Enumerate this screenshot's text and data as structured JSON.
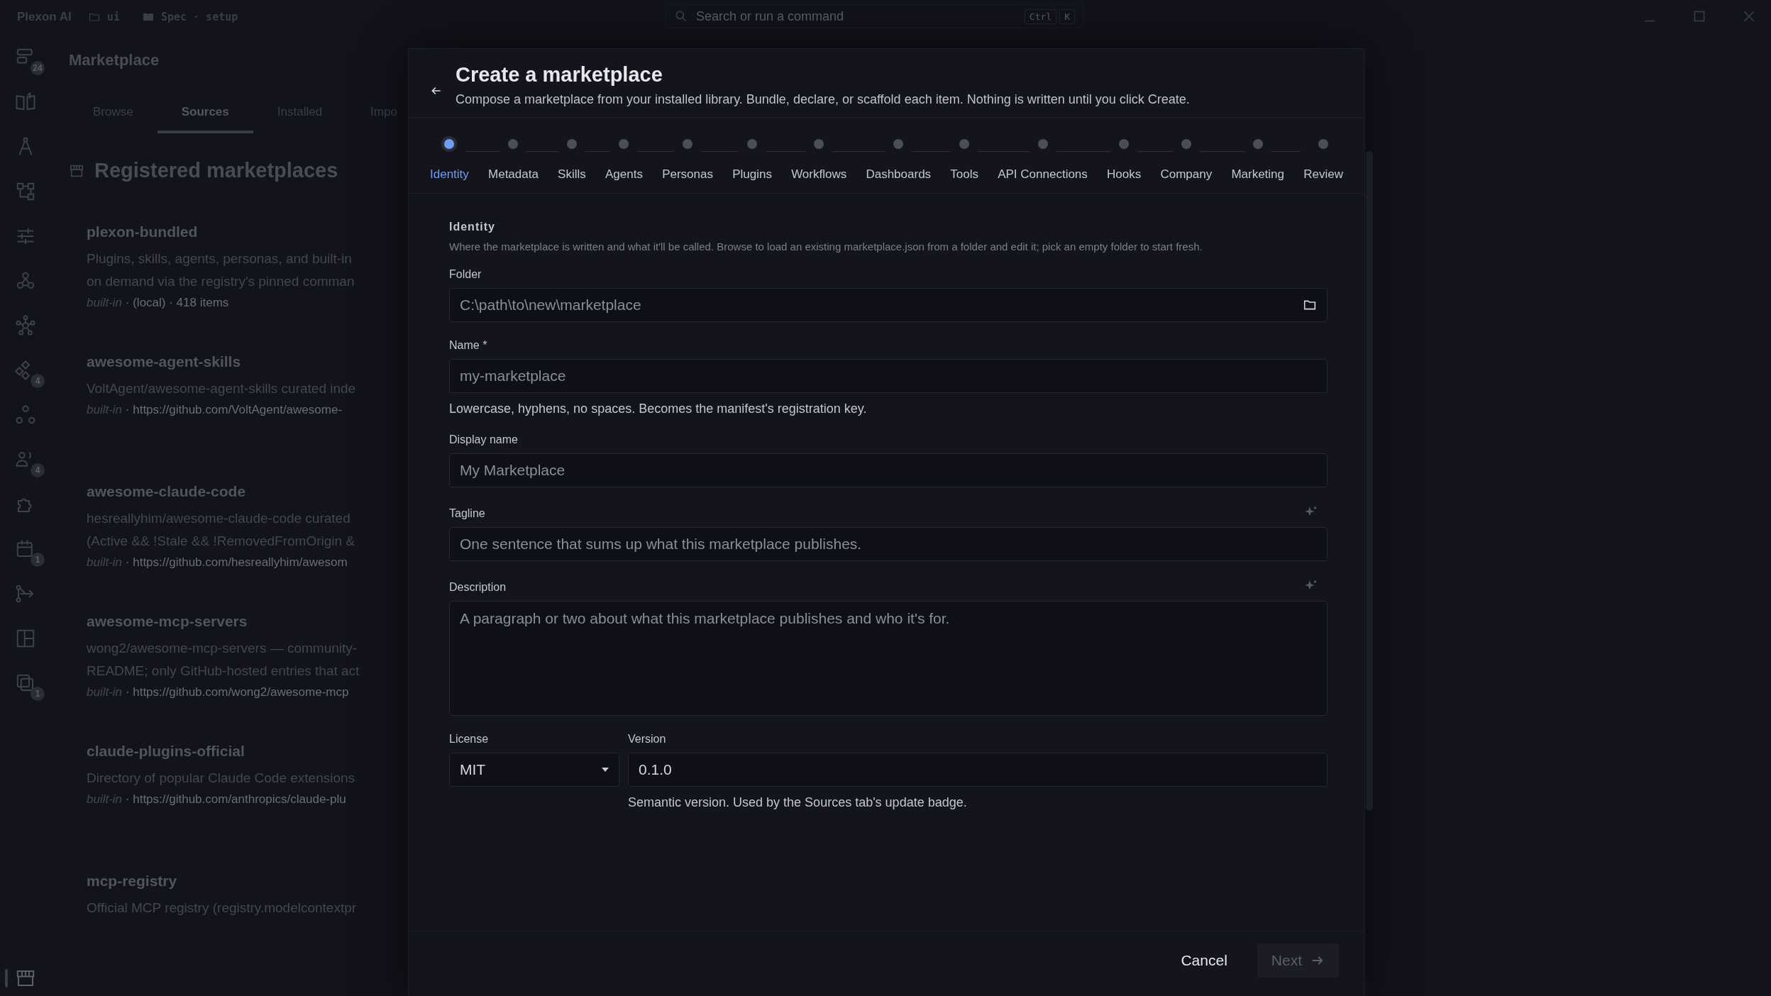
{
  "titlebar": {
    "app_name": "Plexon AI",
    "workspace": "ui",
    "spec": "Spec · setup",
    "search": {
      "placeholder": "Search or run a command",
      "keys": [
        "Ctrl",
        "K"
      ]
    }
  },
  "rail": {
    "items": [
      {
        "badge": "24",
        "selected": false
      },
      {
        "selected": false
      },
      {
        "selected": false
      },
      {
        "selected": false
      },
      {
        "selected": false
      },
      {
        "selected": false
      },
      {
        "selected": false
      },
      {
        "badge": "4",
        "selected": false
      },
      {
        "selected": false
      },
      {
        "badge": "4",
        "selected": false
      },
      {
        "selected": false
      },
      {
        "badge": "1",
        "selected": false
      },
      {
        "selected": false
      },
      {
        "selected": false
      },
      {
        "badge": "1",
        "selected": false
      },
      {
        "selected": true
      }
    ]
  },
  "marketplace": {
    "title": "Marketplace",
    "tabs": [
      {
        "label": "Browse",
        "selected": false
      },
      {
        "label": "Sources",
        "selected": true
      },
      {
        "label": "Installed",
        "selected": false
      },
      {
        "label": "Impo",
        "selected": false
      }
    ],
    "section_title": "Registered marketplaces",
    "sources": [
      {
        "name": "plexon-bundled",
        "description": [
          "Plugins, skills, agents, personas, and built-in",
          "on demand via the registry's pinned comman"
        ],
        "origin": "built-in",
        "detail": "· (local) · 418 items"
      },
      {
        "name": "awesome-agent-skills",
        "description": [
          "VoltAgent/awesome-agent-skills curated inde"
        ],
        "origin": "built-in",
        "detail": "· https://github.com/VoltAgent/awesome-"
      },
      {
        "name": "awesome-claude-code",
        "description": [
          "hesreallyhim/awesome-claude-code curated",
          "(Active && !Stale && !RemovedFromOrigin &"
        ],
        "origin": "built-in",
        "detail": "· https://github.com/hesreallyhim/awesom"
      },
      {
        "name": "awesome-mcp-servers",
        "description": [
          "wong2/awesome-mcp-servers — community-",
          "README; only GitHub-hosted entries that act"
        ],
        "origin": "built-in",
        "detail": "· https://github.com/wong2/awesome-mcp"
      },
      {
        "name": "claude-plugins-official",
        "description": [
          "Directory of popular Claude Code extensions"
        ],
        "origin": "built-in",
        "detail": "· https://github.com/anthropics/claude-plu"
      },
      {
        "name": "mcp-registry",
        "description": [
          "Official MCP registry (registry.modelcontextpr"
        ]
      }
    ]
  },
  "dialog": {
    "title": "Create a marketplace",
    "subtitle": "Compose a marketplace from your installed library. Bundle, declare, or scaffold each item. Nothing is written until you click Create.",
    "steps": [
      {
        "label": "Identity",
        "selected": true
      },
      {
        "label": "Metadata",
        "selected": false
      },
      {
        "label": "Skills",
        "selected": false
      },
      {
        "label": "Agents",
        "selected": false
      },
      {
        "label": "Personas",
        "selected": false
      },
      {
        "label": "Plugins",
        "selected": false
      },
      {
        "label": "Workflows",
        "selected": false
      },
      {
        "label": "Dashboards",
        "selected": false
      },
      {
        "label": "Tools",
        "selected": false
      },
      {
        "label": "API Connections",
        "selected": false
      },
      {
        "label": "Hooks",
        "selected": false
      },
      {
        "label": "Company",
        "selected": false
      },
      {
        "label": "Marketing",
        "selected": false
      },
      {
        "label": "Review",
        "selected": false
      }
    ],
    "section": {
      "title": "Identity",
      "description": "Where the marketplace is written and what it'll be called. Browse to load an existing marketplace.json from a folder and edit it; pick an empty folder to start fresh."
    },
    "rows": [
      [
        {
          "kind": "text",
          "label": "Folder",
          "placeholder": "C:\\path\\to\\new\\marketplace",
          "browse": true
        }
      ],
      [
        {
          "kind": "text",
          "label": "Name *",
          "placeholder": "my-marketplace",
          "hint": "Lowercase, hyphens, no spaces. Becomes the manifest's registration key."
        }
      ],
      [
        {
          "kind": "text",
          "label": "Display name",
          "placeholder": "My Marketplace"
        }
      ],
      [
        {
          "kind": "text",
          "label": "Tagline",
          "placeholder": "One sentence that sums up what this marketplace publishes.",
          "ai_assist": true
        }
      ],
      [
        {
          "kind": "textarea",
          "label": "Description",
          "placeholder": "A paragraph or two about what this marketplace publishes and who it's for.",
          "ai_assist": true
        }
      ],
      [
        {
          "kind": "select",
          "label": "License",
          "value": "MIT"
        },
        {
          "kind": "text",
          "label": "Version",
          "value": "0.1.0",
          "hint": "Semantic version. Used by the Sources tab's update badge."
        }
      ]
    ],
    "cancel": "Cancel",
    "next": {
      "label": "Next",
      "disabled": true
    }
  }
}
